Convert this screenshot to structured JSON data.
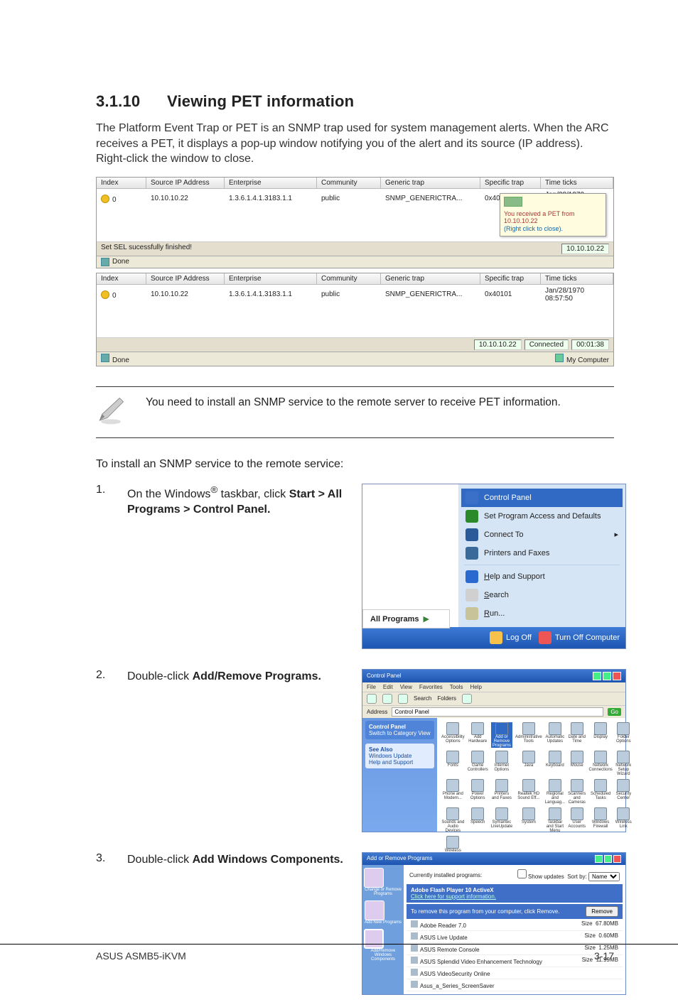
{
  "heading_number": "3.1.10",
  "heading_title": "Viewing PET information",
  "intro": "The Platform Event Trap or PET is an SNMP trap used for system management alerts. When the ARC receives a PET, it displays a pop-up window notifying you of the alert and its source (IP address). Right-click the window to close.",
  "table_headers": {
    "index": "Index",
    "source_ip": "Source IP Address",
    "enterprise": "Enterprise",
    "community": "Community",
    "generic": "Generic trap",
    "specific": "Specific trap",
    "time": "Time ticks"
  },
  "table1_row": {
    "index": "0",
    "ip": "10.10.10.22",
    "enterprise": "1.3.6.1.4.1.3183.1.1",
    "community": "public",
    "generic": "SNMP_GENERICTRA...",
    "specific": "0x40101",
    "time": "Jan/28/1970 08:57:58"
  },
  "table1_status_left": "Set SEL sucessfully finished!",
  "table1_status_right": "10.10.10.22",
  "popup_line1": "You received a PET from",
  "popup_line2": "10.10.10.22",
  "popup_line3": "(Right click to close).",
  "done": "Done",
  "table2_row": {
    "index": "0",
    "ip": "10.10.10.22",
    "enterprise": "1.3.6.1.4.1.3183.1.1",
    "community": "public",
    "generic": "SNMP_GENERICTRA...",
    "specific": "0x40101",
    "time": "Jan/28/1970 08:57:50"
  },
  "table2_status_ip": "10.10.10.22",
  "table2_status_conn": "Connected",
  "table2_status_time": "00:01:38",
  "mycomputer": "My Computer",
  "note": "You need to install an SNMP service to the remote server to receive PET information.",
  "lead": "To install an SNMP service to the remote service:",
  "step1_num": "1.",
  "step1_pre": "On the Windows",
  "step1_reg": "®",
  "step1_post": " taskbar, click ",
  "step1_bold": "Start > All Programs > Control Panel.",
  "start_menu": {
    "all_programs": "All Programs",
    "items": [
      {
        "label": "Control Panel",
        "hl": true,
        "color": "#3a70c8"
      },
      {
        "label": "Set Program Access and Defaults",
        "color": "#2a8a2a"
      },
      {
        "label": "Connect To",
        "color": "#2a5a9a"
      },
      {
        "label": "Printers and Faxes",
        "color": "#3a6a9a"
      }
    ],
    "items2": [
      {
        "label": "Help and Support",
        "color": "#2a6ad0"
      },
      {
        "label": "Search",
        "color": "#d0d0d0"
      },
      {
        "label": "Run...",
        "color": "#c9c39a"
      }
    ],
    "logoff": "Log Off",
    "turnoff": "Turn Off Computer"
  },
  "step2_num": "2.",
  "step2_pre": "Double-click ",
  "step2_bold": "Add/Remove Programs.",
  "cp": {
    "title": "Control Panel",
    "menu": [
      "File",
      "Edit",
      "View",
      "Favorites",
      "Tools",
      "Help"
    ],
    "addr_label": "Address",
    "addr_value": "Control Panel",
    "go": "Go",
    "side_head": "Control Panel",
    "side_switch": "Switch to Category View",
    "side_see": "See Also",
    "side_items": [
      "Windows Update",
      "Help and Support"
    ],
    "icons": [
      "Accessibility Options",
      "Add Hardware",
      "Add or Remove Programs",
      "Administrative Tools",
      "Automatic Updates",
      "Date and Time",
      "Display",
      "Folder Options",
      "Fonts",
      "Game Controllers",
      "Internet Options",
      "Java",
      "Keyboard",
      "Mouse",
      "Network Connections",
      "Network Setup Wizard",
      "Phone and Modem...",
      "Power Options",
      "Printers and Faxes",
      "Realtek HD Sound Eff...",
      "Regional and Languag...",
      "Scanners and Cameras",
      "Scheduled Tasks",
      "Security Center",
      "Sounds and Audio Devices",
      "Speech",
      "Symantec LiveUpdate",
      "System",
      "Taskbar and Start Menu",
      "User Accounts",
      "Windows Firewall",
      "Wireless Link",
      "Wireless Network Set..."
    ],
    "hl_index": 2
  },
  "step3_num": "3.",
  "step3_pre": "Double-click ",
  "step3_bold": "Add Windows Components.",
  "arp": {
    "title": "Add or Remove Programs",
    "side": [
      "Change or Remove Programs",
      "Add New Programs",
      "Add/Remove Windows Components"
    ],
    "top_label": "Currently installed programs:",
    "show_updates": "Show updates",
    "sort_by": "Sort by:",
    "sort_val": "Name",
    "sel_name": "Adobe Flash Player 10 ActiveX",
    "sel_support": "Click here for support information.",
    "sel_remove_text": "To remove this program from your computer, click Remove.",
    "remove_btn": "Remove",
    "rows": [
      {
        "name": "Adobe Reader 7.0",
        "size": "67.80MB"
      },
      {
        "name": "ASUS Live Update",
        "size": "0.60MB"
      },
      {
        "name": "ASUS Remote Console",
        "size": "1.25MB"
      },
      {
        "name": "ASUS Splendid Video Enhancement Technology",
        "size": "11.99MB"
      },
      {
        "name": "ASUS VideoSecurity Online",
        "size": ""
      },
      {
        "name": "Asus_a_Series_ScreenSaver",
        "size": ""
      }
    ],
    "size_label": "Size"
  },
  "footer_left": "ASUS ASMB5-iKVM",
  "footer_right": "3-17"
}
